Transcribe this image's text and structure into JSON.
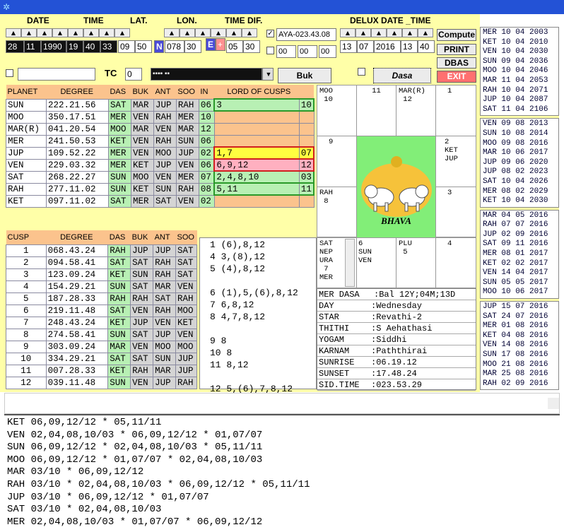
{
  "app": {
    "icon": "app-icon"
  },
  "headers": {
    "date": "DATE",
    "time": "TIME",
    "lat": "LAT.",
    "lon": "LON.",
    "timedif": "TIME DIF.",
    "delux": "DELUX DATE _TIME",
    "tc": "TC"
  },
  "inputs": {
    "date": [
      "28",
      "11",
      "1990"
    ],
    "time": [
      "19",
      "40",
      "33"
    ],
    "lat": [
      "09",
      "50"
    ],
    "lat_dir": "N",
    "lon": [
      "078",
      "30"
    ],
    "lon_dir": "E",
    "sign": "+",
    "timedif": [
      "05",
      "30"
    ],
    "aya": "AYA-023.43.08",
    "blanks": [
      "00",
      "00",
      "00"
    ],
    "delux": [
      "13",
      "07",
      "2016",
      "13",
      "40"
    ],
    "tc": "0",
    "note": "",
    "combo": "▪▪▪▪ ▪▪"
  },
  "buttons": {
    "compute": "Compute",
    "print": "PRINT",
    "dbas": "DBAS",
    "exit": "EXIT",
    "buk": "Buk",
    "dasa": "Dasa"
  },
  "planet_table": {
    "headers": [
      "PLANET",
      "DEGREE",
      "DAS",
      "BUK",
      "ANT",
      "SOO",
      "IN",
      "LORD OF CUSPS"
    ],
    "rows": [
      [
        "SUN",
        "222.21.56",
        "SAT",
        "MAR",
        "JUP",
        "RAH",
        "06",
        "3",
        "10"
      ],
      [
        "MOO",
        "350.17.51",
        "MER",
        "VEN",
        "RAH",
        "MER",
        "10",
        "",
        ""
      ],
      [
        "MAR(R)",
        "041.20.54",
        "MOO",
        "MAR",
        "VEN",
        "MAR",
        "12",
        "",
        ""
      ],
      [
        "MER",
        "241.50.53",
        "KET",
        "VEN",
        "RAH",
        "SUN",
        "06",
        "",
        ""
      ],
      [
        "JUP",
        "109.52.22",
        "MER",
        "VEN",
        "MOO",
        "JUP",
        "02",
        "1,7",
        "07"
      ],
      [
        "VEN",
        "229.03.32",
        "MER",
        "KET",
        "JUP",
        "VEN",
        "06",
        "6,9,12",
        "12"
      ],
      [
        "SAT",
        "268.22.27",
        "SUN",
        "MOO",
        "VEN",
        "MER",
        "07",
        "2,4,8,10",
        "03"
      ],
      [
        "RAH",
        "277.11.02",
        "SUN",
        "KET",
        "SUN",
        "RAH",
        "08",
        "5,11",
        "11"
      ],
      [
        "KET",
        "097.11.02",
        "SAT",
        "MER",
        "SAT",
        "VEN",
        "02",
        "",
        ""
      ]
    ]
  },
  "cusp_table": {
    "headers": [
      "CUSP",
      "DEGREE",
      "DAS",
      "BUK",
      "ANT",
      "SOO"
    ],
    "rows": [
      [
        "1",
        "068.43.24",
        "RAH",
        "JUP",
        "JUP",
        "SAT"
      ],
      [
        "2",
        "094.58.41",
        "SAT",
        "SAT",
        "RAH",
        "SAT"
      ],
      [
        "3",
        "123.09.24",
        "KET",
        "SUN",
        "RAH",
        "SAT"
      ],
      [
        "4",
        "154.29.21",
        "SUN",
        "SAT",
        "MAR",
        "VEN"
      ],
      [
        "5",
        "187.28.33",
        "RAH",
        "RAH",
        "SAT",
        "RAH"
      ],
      [
        "6",
        "219.11.48",
        "SAT",
        "VEN",
        "RAH",
        "MOO"
      ],
      [
        "7",
        "248.43.24",
        "KET",
        "JUP",
        "VEN",
        "KET"
      ],
      [
        "8",
        "274.58.41",
        "SUN",
        "SAT",
        "JUP",
        "VEN"
      ],
      [
        "9",
        "303.09.24",
        "MAR",
        "VEN",
        "MOO",
        "MOO"
      ],
      [
        "10",
        "334.29.21",
        "SAT",
        "SAT",
        "SUN",
        "JUP"
      ],
      [
        "11",
        "007.28.33",
        "KET",
        "RAH",
        "MAR",
        "JUP"
      ],
      [
        "12",
        "039.11.48",
        "SUN",
        "VEN",
        "JUP",
        "RAH"
      ]
    ]
  },
  "significators": [
    "1 (6),8,12",
    "4 3,(8),12",
    "5 (4),8,12",
    "",
    "6 (1),5,(6),8,12",
    "7 6,8,12",
    "8 4,7,8,12",
    "",
    "9 8",
    "10 8",
    "11 8,12",
    "",
    "12 5,(6),7,8,12"
  ],
  "chart": {
    "c1": "MOO\n 10",
    "c2": "11",
    "c3": "MAR(R)\n 12",
    "c4": "1",
    "c5": "9",
    "c6": "2\nKET\nJUP",
    "c7": "RAH\n 8",
    "c8": "3",
    "c9": "SAT\nNEP\nURA\n 7\nMER",
    "c10": "6\nSUN\nVEN",
    "c11": "PLU\n 5",
    "c12": "4",
    "bhava": "BHAVA"
  },
  "info": [
    [
      "MER DASA",
      "Bal 12Y;04M;13D"
    ],
    [
      "DAY",
      ":Wednesday"
    ],
    [
      "STAR",
      ":Revathi-2"
    ],
    [
      "THITHI",
      ":S Aehathasi"
    ],
    [
      "YOGAM",
      ":Siddhi"
    ],
    [
      "KARNAM",
      ":Paththirai"
    ],
    [
      "SUNRISE",
      ":06.19.12"
    ],
    [
      "SUNSET",
      ":17.48.24"
    ],
    [
      "SID.TIME",
      ":023.53.29"
    ]
  ],
  "right_dasa": [
    [
      "MER 10 04 2003",
      "KET 10 04 2010",
      "VEN 10 04 2030",
      "SUN 09 04 2036",
      "MOO 10 04 2046",
      "MAR 11 04 2053",
      "RAH 10 04 2071",
      "JUP 10 04 2087",
      "SAT 11 04 2106"
    ],
    [
      "VEN 09 08 2013",
      "SUN 10 08 2014",
      "MOO 09 08 2016",
      "MAR 10 06 2017",
      "JUP 09 06 2020",
      "JUP 08 02 2023",
      "SAT 10 04 2026",
      "MER 08 02 2029",
      "KET 10 04 2030"
    ],
    [
      "MAR 04 05 2016",
      "RAH 07 07 2016",
      "JUP 02 09 2016",
      "SAT 09 11 2016",
      "MER 08 01 2017",
      "KET 02 02 2017",
      "VEN 14 04 2017",
      "SUN 05 05 2017",
      "MOO 10 06 2017"
    ],
    [
      "JUP 15 07 2016",
      "SAT 24 07 2016",
      "MER 01 08 2016",
      "KET 04 08 2016",
      "VEN 14 08 2016",
      "SUN 17 08 2016",
      "MOO 21 08 2016",
      "MAR 25 08 2016",
      "RAH 02 09 2016"
    ]
  ],
  "output_lines": [
    "KET 06,09,12/12 * 05,11/11",
    "VEN 02,04,08,10/03 * 06,09,12/12 * 01,07/07",
    "SUN 06,09,12/12 * 02,04,08,10/03 * 05,11/11",
    "MOO 06,09,12/12 * 01,07/07 * 02,04,08,10/03",
    "MAR 03/10 * 06,09,12/12",
    "RAH 03/10 * 02,04,08,10/03 * 06,09,12/12 * 05,11/11",
    "JUP 03/10 * 06,09,12/12 * 01,07/07",
    "SAT 03/10 * 02,04,08,10/03",
    "MER 02,04,08,10/03 * 01,07/07 * 06,09,12/12"
  ],
  "colors": {
    "accent": "#2352d6",
    "panel": "#ffffa8",
    "header": "#fbc38d",
    "green": "#b8f0b4",
    "exit": "#ff7070"
  }
}
